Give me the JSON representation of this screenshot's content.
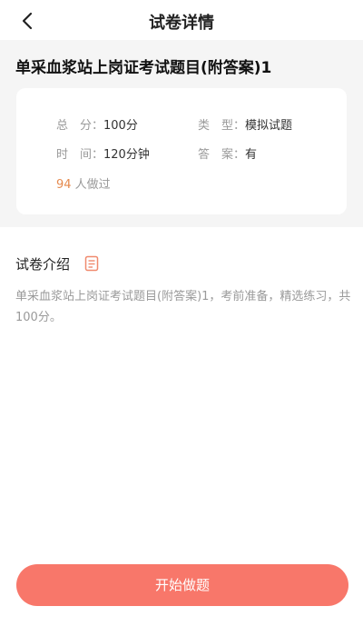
{
  "nav": {
    "title": "试卷详情"
  },
  "paper": {
    "title": "单采血浆站上岗证考试题目(附答案)1",
    "total_label": "总　分：",
    "total_value": "100分",
    "type_label": "类　型：",
    "type_value": "模拟试题",
    "time_label": "时　间：",
    "time_value": "120分钟",
    "answer_label": "答　案：",
    "answer_value": "有",
    "done_count": "94",
    "done_suffix": " 人做过"
  },
  "intro": {
    "heading": "试卷介绍",
    "text": "单采血浆站上岗证考试题目(附答案)1，考前准备，精选练习，共100分。"
  },
  "actions": {
    "start_label": "开始做题"
  },
  "colors": {
    "accent": "#f8776a",
    "count": "#e58a4e",
    "section_bg": "#f5f5f5"
  },
  "icons": {
    "back": "chevron-left-icon",
    "intro": "document-icon"
  }
}
